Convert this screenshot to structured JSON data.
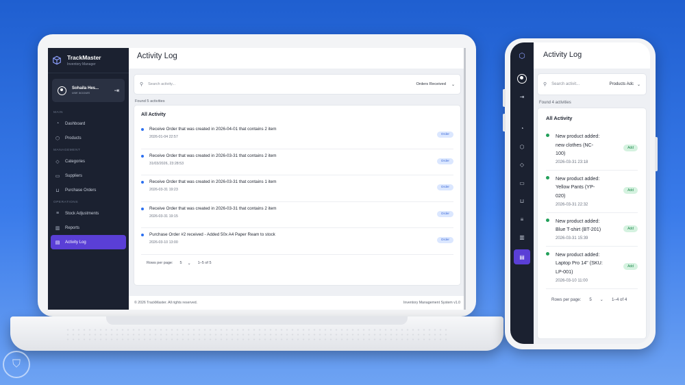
{
  "laptop": {
    "brand": {
      "title": "TrackMaster",
      "subtitle": "Inventory Manager"
    },
    "user": {
      "name": "Sohaila Hes...",
      "role": "user account"
    },
    "sections": {
      "main": "MAIN",
      "management": "MANAGEMENT",
      "operations": "OPERATIONS"
    },
    "nav": {
      "dashboard": "Dashboard",
      "products": "Products",
      "categories": "Categories",
      "suppliers": "Suppliers",
      "purchase_orders": "Purchase Orders",
      "stock_adjustments": "Stock Adjustments",
      "reports": "Reports",
      "activity_log": "Activity Log"
    },
    "page_title": "Activity Log",
    "search": {
      "placeholder": "Search activity...",
      "filter": "Orders Received"
    },
    "found": "Found 5 activities",
    "card_title": "All Activity",
    "activities": [
      {
        "text": "Receive Order that was created in 2026-04-01 that contains 2 item",
        "date": "2026-01-04 22:57",
        "badge": "Order"
      },
      {
        "text": "Receive Order that was created in 2026-03-31 that contains 2 item",
        "date": "31/03/2026, 23:28:53",
        "badge": "Order"
      },
      {
        "text": "Receive Order that was created in 2026-03-31 that contains 1 item",
        "date": "2026-03-31 19:23",
        "badge": "Order"
      },
      {
        "text": "Receive Order that was created in 2026-03-31 that contains 2 item",
        "date": "2026-03-31 19:15",
        "badge": "Order"
      },
      {
        "text": "Purchase Order #2 received - Added 50x A4 Paper Ream to stock",
        "date": "2026-03-10 13:00",
        "badge": "Order"
      }
    ],
    "pager": {
      "label": "Rows per page:",
      "value": "5",
      "range": "1–5 of 5"
    },
    "footer": {
      "left": "© 2026 TrackMaster. All rights reserved.",
      "right": "Inventory Management System v1.0"
    }
  },
  "phone": {
    "page_title": "Activity Log",
    "search": {
      "placeholder": "Search activit...",
      "filter": "Products Adc"
    },
    "found": "Found 4 activities",
    "card_title": "All Activity",
    "activities": [
      {
        "line1": "New product added:",
        "line2": "new clothes (NC-",
        "line3": "100)",
        "date": "2026-03-31 23:18",
        "badge": "Add"
      },
      {
        "line1": "New product added:",
        "line2": "Yellow Pants (YP-",
        "line3": "020)",
        "date": "2026-03-31 22:32",
        "badge": "Add"
      },
      {
        "line1": "New product added:",
        "line2": "Blue T-shirt (BT-201)",
        "line3": "",
        "date": "2026-03-31 15:39",
        "badge": "Add"
      },
      {
        "line1": "New product added:",
        "line2": "Laptop Pro 14\" (SKU:",
        "line3": "LP-001)",
        "date": "2026-03-10 11:00",
        "badge": "Add"
      }
    ],
    "pager": {
      "label": "Rows per page:",
      "value": "5",
      "range": "1–4 of 4"
    }
  },
  "colors": {
    "accent": "#5a3fd6",
    "sidebar": "#1b2130",
    "order_dot": "#2b6ff0",
    "add_dot": "#23a05a"
  }
}
